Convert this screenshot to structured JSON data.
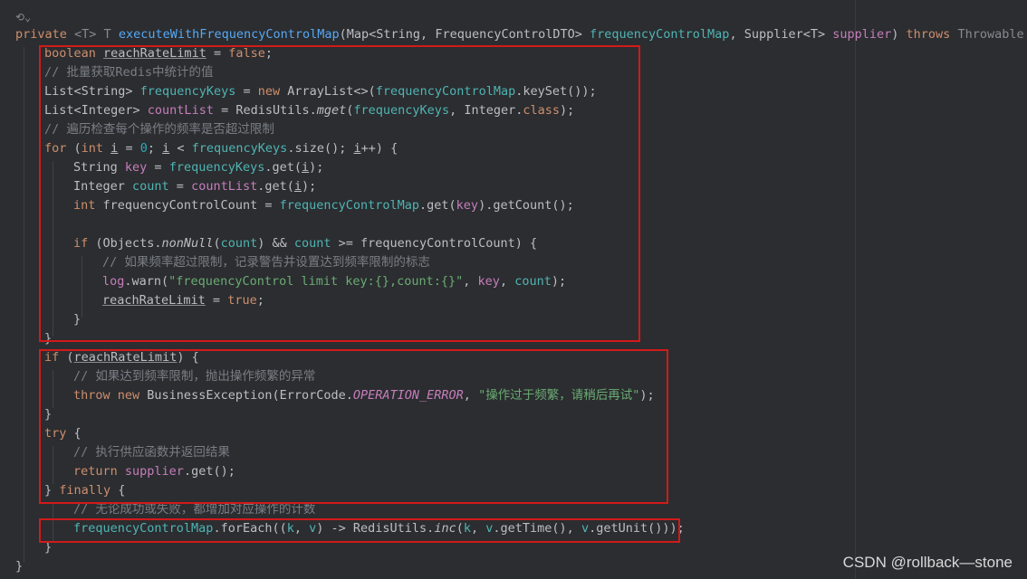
{
  "fold_icon": "fold-chevron-icon",
  "watermark": "CSDN @rollback—stone",
  "highlight_color": "#d21a1a",
  "code_lines": [
    {
      "indent": 0,
      "tokens": [
        [
          "private ",
          "kw"
        ],
        [
          "<T> ",
          "gray"
        ],
        [
          "T ",
          "gray"
        ],
        [
          "executeWithFrequencyControlMap",
          "fn"
        ],
        [
          "(Map<String, FrequencyControlDTO> ",
          ""
        ],
        [
          "frequencyControlMap",
          "param"
        ],
        [
          ", Supplier<T> ",
          ""
        ],
        [
          "supplier",
          "fld"
        ],
        [
          ") ",
          ""
        ],
        [
          "throws ",
          "kw"
        ],
        [
          "Throwable ",
          "gray"
        ],
        [
          "{",
          ""
        ]
      ]
    },
    {
      "indent": 1,
      "tokens": [
        [
          "boolean ",
          "kw"
        ],
        [
          "reachRateLimit",
          "und"
        ],
        [
          " = ",
          ""
        ],
        [
          "false",
          "kw"
        ],
        [
          ";",
          ""
        ]
      ]
    },
    {
      "indent": 1,
      "tokens": [
        [
          "// 批量获取Redis中统计的值",
          "cmt"
        ]
      ]
    },
    {
      "indent": 1,
      "tokens": [
        [
          "List<String> ",
          ""
        ],
        [
          "frequencyKeys",
          "param"
        ],
        [
          " = ",
          ""
        ],
        [
          "new ",
          "kw"
        ],
        [
          "ArrayList<>(",
          ""
        ],
        [
          "frequencyControlMap",
          "param"
        ],
        [
          ".keySet());",
          ""
        ]
      ]
    },
    {
      "indent": 1,
      "tokens": [
        [
          "List<Integer> ",
          ""
        ],
        [
          "countList",
          "fld"
        ],
        [
          " = RedisUtils.",
          ""
        ],
        [
          "mget",
          "smi"
        ],
        [
          "(",
          ""
        ],
        [
          "frequencyKeys",
          "param"
        ],
        [
          ", Integer.",
          ""
        ],
        [
          "class",
          "kw"
        ],
        [
          ");",
          ""
        ]
      ]
    },
    {
      "indent": 1,
      "tokens": [
        [
          "// 遍历检查每个操作的频率是否超过限制",
          "cmt"
        ]
      ]
    },
    {
      "indent": 1,
      "tokens": [
        [
          "for ",
          "kw"
        ],
        [
          "(",
          ""
        ],
        [
          "int ",
          "kw"
        ],
        [
          "i",
          "undk"
        ],
        [
          " = ",
          ""
        ],
        [
          "0",
          "num"
        ],
        [
          "; ",
          ""
        ],
        [
          "i",
          "undk"
        ],
        [
          " < ",
          ""
        ],
        [
          "frequencyKeys",
          "param"
        ],
        [
          ".size(); ",
          ""
        ],
        [
          "i",
          "undk"
        ],
        [
          "++) {",
          ""
        ]
      ]
    },
    {
      "indent": 2,
      "tokens": [
        [
          "String ",
          ""
        ],
        [
          "key",
          "fld"
        ],
        [
          " = ",
          ""
        ],
        [
          "frequencyKeys",
          "param"
        ],
        [
          ".get(",
          ""
        ],
        [
          "i",
          "undk"
        ],
        [
          ");",
          ""
        ]
      ]
    },
    {
      "indent": 2,
      "tokens": [
        [
          "Integer ",
          ""
        ],
        [
          "count",
          "param"
        ],
        [
          " = ",
          ""
        ],
        [
          "countList",
          "fld"
        ],
        [
          ".get(",
          ""
        ],
        [
          "i",
          "undk"
        ],
        [
          ");",
          ""
        ]
      ]
    },
    {
      "indent": 2,
      "tokens": [
        [
          "int ",
          "kw"
        ],
        [
          "frequencyControlCount = ",
          ""
        ],
        [
          "frequencyControlMap",
          "param"
        ],
        [
          ".get(",
          ""
        ],
        [
          "key",
          "fld"
        ],
        [
          ").getCount();",
          ""
        ]
      ]
    },
    {
      "indent": 0,
      "tokens": []
    },
    {
      "indent": 2,
      "tokens": [
        [
          "if ",
          "kw"
        ],
        [
          "(Objects.",
          ""
        ],
        [
          "nonNull",
          "smi"
        ],
        [
          "(",
          ""
        ],
        [
          "count",
          "param"
        ],
        [
          ") && ",
          ""
        ],
        [
          "count",
          "param"
        ],
        [
          " >= frequencyControlCount) {",
          ""
        ]
      ]
    },
    {
      "indent": 3,
      "tokens": [
        [
          "// 如果频率超过限制，记录警告并设置达到频率限制的标志",
          "cmt"
        ]
      ]
    },
    {
      "indent": 3,
      "tokens": [
        [
          "log",
          "fld"
        ],
        [
          ".warn(",
          ""
        ],
        [
          "\"frequencyControl limit key:{},count:{}\"",
          "str"
        ],
        [
          ", ",
          ""
        ],
        [
          "key",
          "fld"
        ],
        [
          ", ",
          ""
        ],
        [
          "count",
          "param"
        ],
        [
          ");",
          ""
        ]
      ]
    },
    {
      "indent": 3,
      "tokens": [
        [
          "reachRateLimit",
          "und"
        ],
        [
          " = ",
          ""
        ],
        [
          "true",
          "kw"
        ],
        [
          ";",
          ""
        ]
      ]
    },
    {
      "indent": 2,
      "tokens": [
        [
          "}",
          ""
        ]
      ]
    },
    {
      "indent": 1,
      "tokens": [
        [
          "}",
          ""
        ]
      ]
    },
    {
      "indent": 1,
      "tokens": [
        [
          "if ",
          "kw"
        ],
        [
          "(",
          ""
        ],
        [
          "reachRateLimit",
          "und"
        ],
        [
          ") {",
          ""
        ]
      ]
    },
    {
      "indent": 2,
      "tokens": [
        [
          "// 如果达到频率限制，抛出操作频繁的异常",
          "cmt"
        ]
      ]
    },
    {
      "indent": 2,
      "tokens": [
        [
          "throw ",
          "kw"
        ],
        [
          "new ",
          "kw"
        ],
        [
          "BusinessException(ErrorCode.",
          ""
        ],
        [
          "OPERATION_ERROR",
          "static"
        ],
        [
          ", ",
          ""
        ],
        [
          "\"操作过于频繁，请稍后再试\"",
          "str"
        ],
        [
          ");",
          ""
        ]
      ]
    },
    {
      "indent": 1,
      "tokens": [
        [
          "}",
          ""
        ]
      ]
    },
    {
      "indent": 1,
      "tokens": [
        [
          "try ",
          "kw"
        ],
        [
          "{",
          ""
        ]
      ]
    },
    {
      "indent": 2,
      "tokens": [
        [
          "// 执行供应函数并返回结果",
          "cmt"
        ]
      ]
    },
    {
      "indent": 2,
      "tokens": [
        [
          "return ",
          "kw"
        ],
        [
          "supplier",
          "fld"
        ],
        [
          ".get();",
          ""
        ]
      ]
    },
    {
      "indent": 1,
      "tokens": [
        [
          "} ",
          ""
        ],
        [
          "finally ",
          "kw"
        ],
        [
          "{",
          ""
        ]
      ]
    },
    {
      "indent": 2,
      "tokens": [
        [
          "// 无论成功或失败，都增加对应操作的计数",
          "cmt"
        ]
      ]
    },
    {
      "indent": 2,
      "tokens": [
        [
          "frequencyControlMap",
          "param"
        ],
        [
          ".forEach((",
          ""
        ],
        [
          "k",
          "param"
        ],
        [
          ", ",
          ""
        ],
        [
          "v",
          "param"
        ],
        [
          ") -> RedisUtils.",
          ""
        ],
        [
          "inc",
          "smi"
        ],
        [
          "(",
          ""
        ],
        [
          "k",
          "param"
        ],
        [
          ", ",
          ""
        ],
        [
          "v",
          "param"
        ],
        [
          ".getTime(), ",
          ""
        ],
        [
          "v",
          "param"
        ],
        [
          ".getUnit()));",
          ""
        ]
      ]
    },
    {
      "indent": 1,
      "tokens": [
        [
          "}",
          ""
        ]
      ]
    },
    {
      "indent": 0,
      "tokens": [
        [
          "}",
          ""
        ]
      ]
    }
  ]
}
